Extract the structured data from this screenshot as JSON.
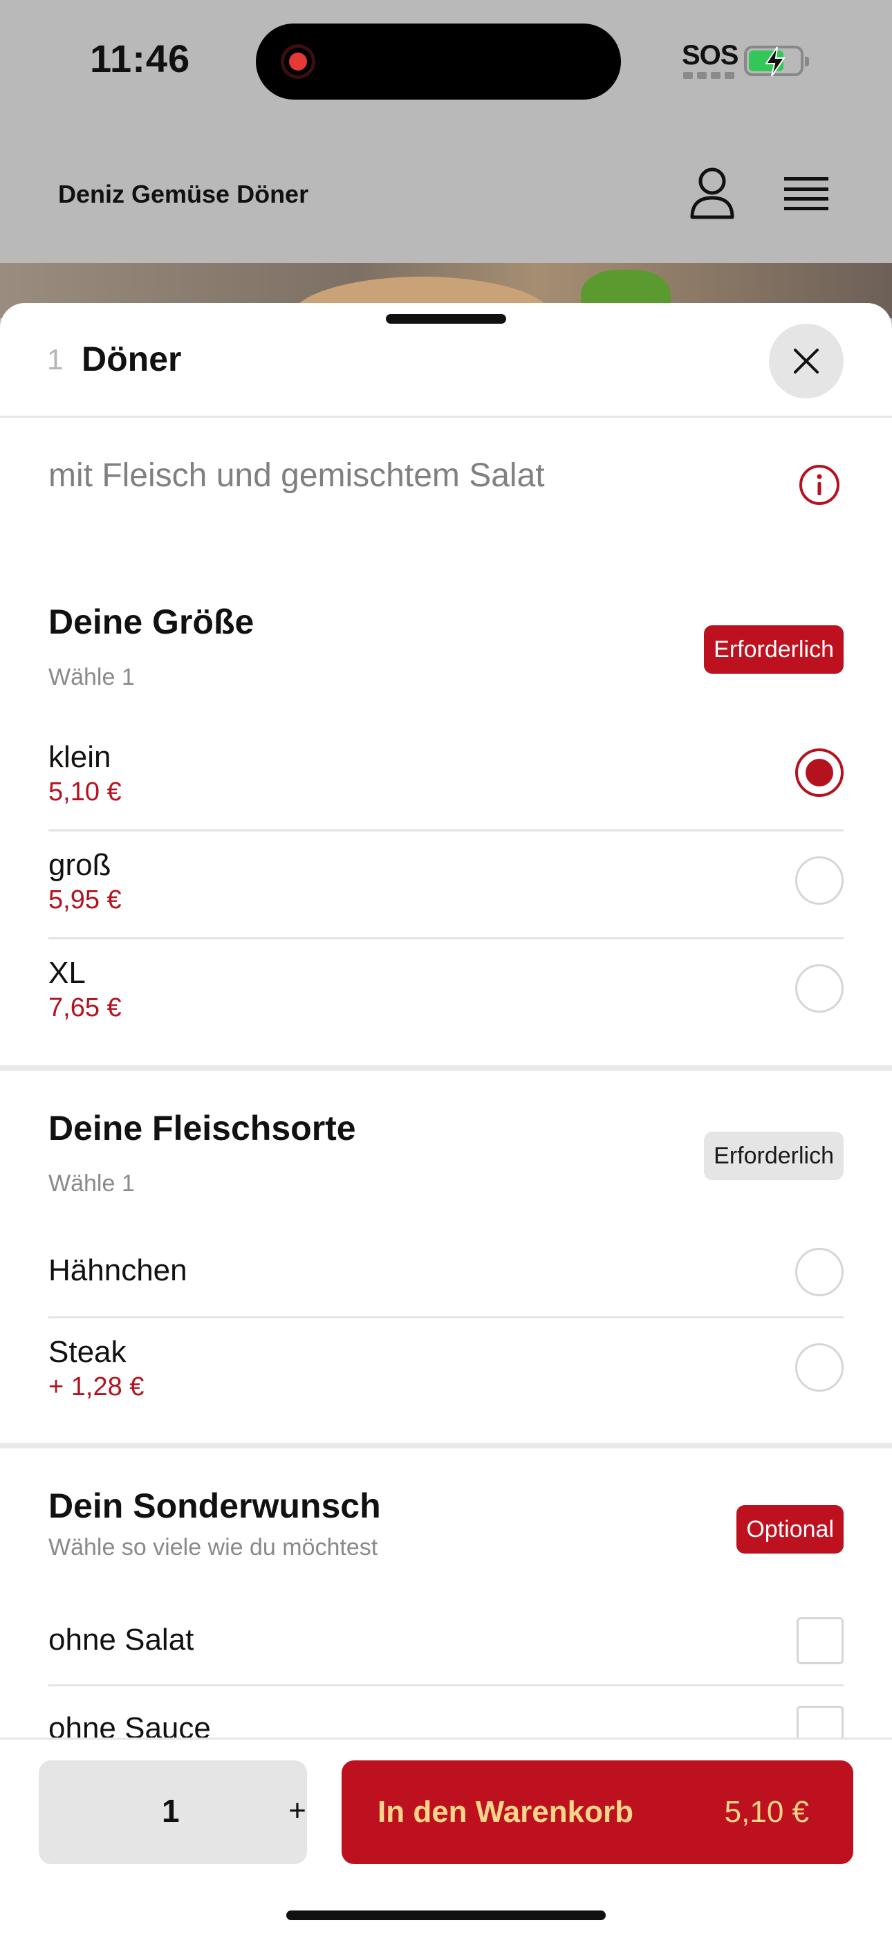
{
  "status_bar": {
    "time": "11:46",
    "sos": "SOS",
    "battery_level": 0.7
  },
  "header": {
    "shop_name": "Deniz Gemüse Döner"
  },
  "sheet": {
    "item_number": "1",
    "item_title": "Döner",
    "description": "mit Fleisch und gemischtem Salat"
  },
  "sections": {
    "size": {
      "title": "Deine Größe",
      "subtitle": "Wähle 1",
      "badge": "Erforderlich",
      "options": [
        {
          "name": "klein",
          "price": "5,10 €",
          "selected": true
        },
        {
          "name": "groß",
          "price": "5,95 €",
          "selected": false
        },
        {
          "name": "XL",
          "price": "7,65 €",
          "selected": false
        }
      ]
    },
    "meat": {
      "title": "Deine Fleischsorte",
      "subtitle": "Wähle 1",
      "badge": "Erforderlich",
      "options": [
        {
          "name": "Hähnchen",
          "price": "",
          "selected": false
        },
        {
          "name": "Steak",
          "price": "+ 1,28 €",
          "selected": false
        }
      ]
    },
    "special": {
      "title": "Dein Sonderwunsch",
      "subtitle": "Wähle so viele wie du möchtest",
      "badge": "Optional",
      "options": [
        {
          "name": "ohne Salat",
          "checked": false
        },
        {
          "name": "ohne Sauce",
          "checked": false
        }
      ]
    }
  },
  "footer": {
    "quantity": "1",
    "plus": "+",
    "cart_label": "In den Warenkorb",
    "cart_total": "5,10 €"
  },
  "colors": {
    "accent": "#bd1120",
    "cart_text": "#ffd58a"
  }
}
